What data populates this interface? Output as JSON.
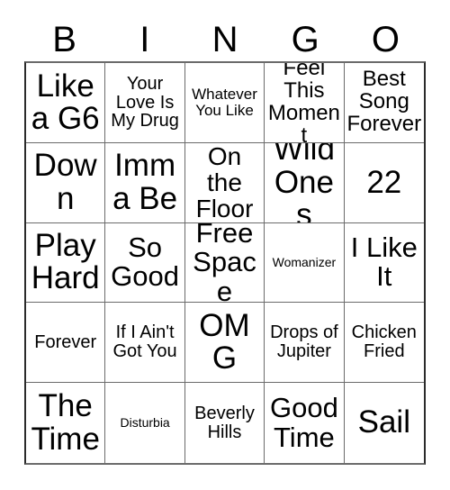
{
  "card": {
    "headers": [
      "B",
      "I",
      "N",
      "G",
      "O"
    ],
    "rows": [
      [
        {
          "text": "Like a G6",
          "size": "xxl"
        },
        {
          "text": "Your Love Is My Drug",
          "size": "s"
        },
        {
          "text": "Whatever You Like",
          "size": "xs"
        },
        {
          "text": "Feel This Moment",
          "size": "m"
        },
        {
          "text": "Best Song Forever",
          "size": "m"
        }
      ],
      [
        {
          "text": "Down",
          "size": "xxl"
        },
        {
          "text": "Imma Be",
          "size": "xxl"
        },
        {
          "text": "On the Floor",
          "size": "l"
        },
        {
          "text": "Wild Ones",
          "size": "xxl"
        },
        {
          "text": "22",
          "size": "xxl"
        }
      ],
      [
        {
          "text": "Play Hard",
          "size": "xxl"
        },
        {
          "text": "So Good",
          "size": "xl"
        },
        {
          "text": "Free Space",
          "size": "xl"
        },
        {
          "text": "Womanizer",
          "size": "xxs"
        },
        {
          "text": "I Like It",
          "size": "xl"
        }
      ],
      [
        {
          "text": "Forever",
          "size": "s"
        },
        {
          "text": "If I Ain't Got You",
          "size": "s"
        },
        {
          "text": "OMG",
          "size": "xxl"
        },
        {
          "text": "Drops of Jupiter",
          "size": "s"
        },
        {
          "text": "Chicken Fried",
          "size": "s"
        }
      ],
      [
        {
          "text": "The Time",
          "size": "xxl"
        },
        {
          "text": "Disturbia",
          "size": "xxs"
        },
        {
          "text": "Beverly Hills",
          "size": "s"
        },
        {
          "text": "Good Time",
          "size": "xl"
        },
        {
          "text": "Sail",
          "size": "xxl"
        }
      ]
    ],
    "free_space_label": "Free Space",
    "colors": {
      "background": "#ffffff",
      "text": "#000000",
      "grid_line": "#6b6b6b",
      "grid_border": "#2b2b2b"
    }
  }
}
